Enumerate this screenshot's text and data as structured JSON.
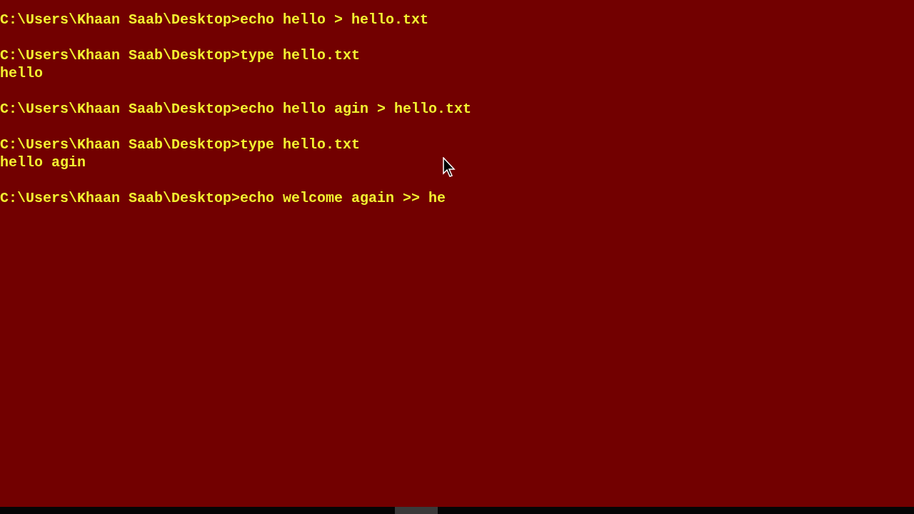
{
  "console": {
    "entries": [
      {
        "prompt": "C:\\Users\\Khaan Saab\\Desktop>",
        "command": "echo hello > hello.txt"
      },
      {
        "prompt": "C:\\Users\\Khaan Saab\\Desktop>",
        "command": "type hello.txt",
        "output": "hello"
      },
      {
        "prompt": "C:\\Users\\Khaan Saab\\Desktop>",
        "command": "echo hello agin > hello.txt"
      },
      {
        "prompt": "C:\\Users\\Khaan Saab\\Desktop>",
        "command": "type hello.txt",
        "output": "hello agin"
      },
      {
        "prompt": "C:\\Users\\Khaan Saab\\Desktop>",
        "command": "echo welcome again >> he"
      }
    ]
  }
}
